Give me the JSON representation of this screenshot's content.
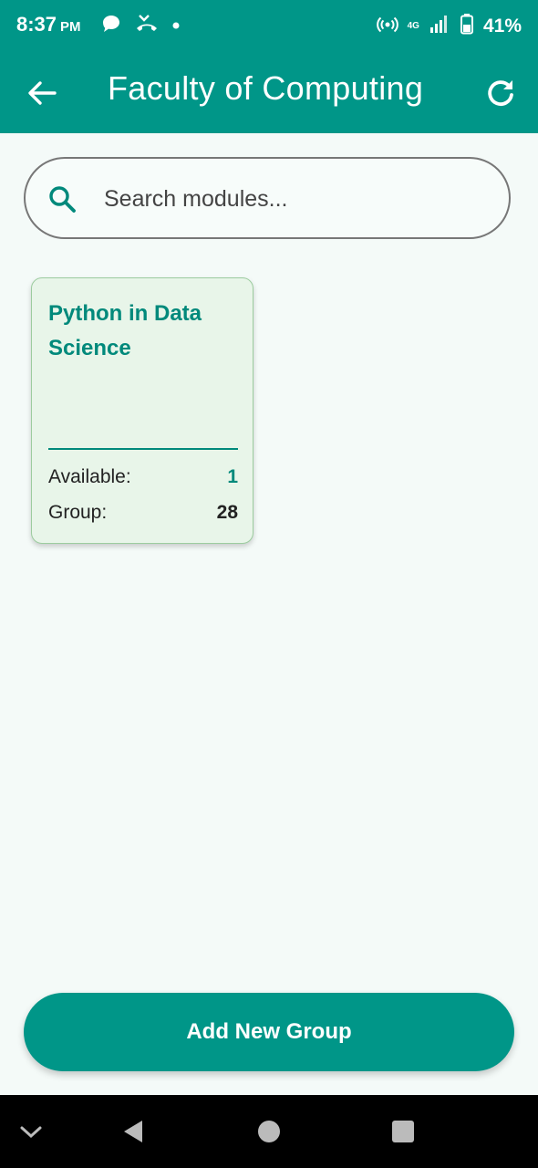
{
  "status_bar": {
    "time": "8:37",
    "ampm": "PM",
    "network": "4G",
    "battery": "41%",
    "icons": [
      "chat-bubble-icon",
      "missed-call-icon",
      "dot-icon",
      "hotspot-icon",
      "signal-icon",
      "battery-icon"
    ]
  },
  "app_bar": {
    "title": "Faculty of Computing",
    "back_icon": "arrow-left-icon",
    "refresh_icon": "refresh-icon"
  },
  "search": {
    "placeholder": "Search modules...",
    "icon": "search-icon"
  },
  "modules": [
    {
      "title": "Python in Data Science",
      "available_label": "Available:",
      "available_value": "1",
      "group_label": "Group:",
      "group_value": "28"
    }
  ],
  "actions": {
    "add_group_label": "Add New Group"
  },
  "nav_bar": {
    "icons": [
      "chevron-down-icon",
      "back-triangle-icon",
      "home-circle-icon",
      "recents-square-icon"
    ]
  },
  "colors": {
    "primary": "#009688",
    "accent_text": "#00897b",
    "card_bg": "#e8f5e9",
    "page_bg": "#f4faf8"
  }
}
